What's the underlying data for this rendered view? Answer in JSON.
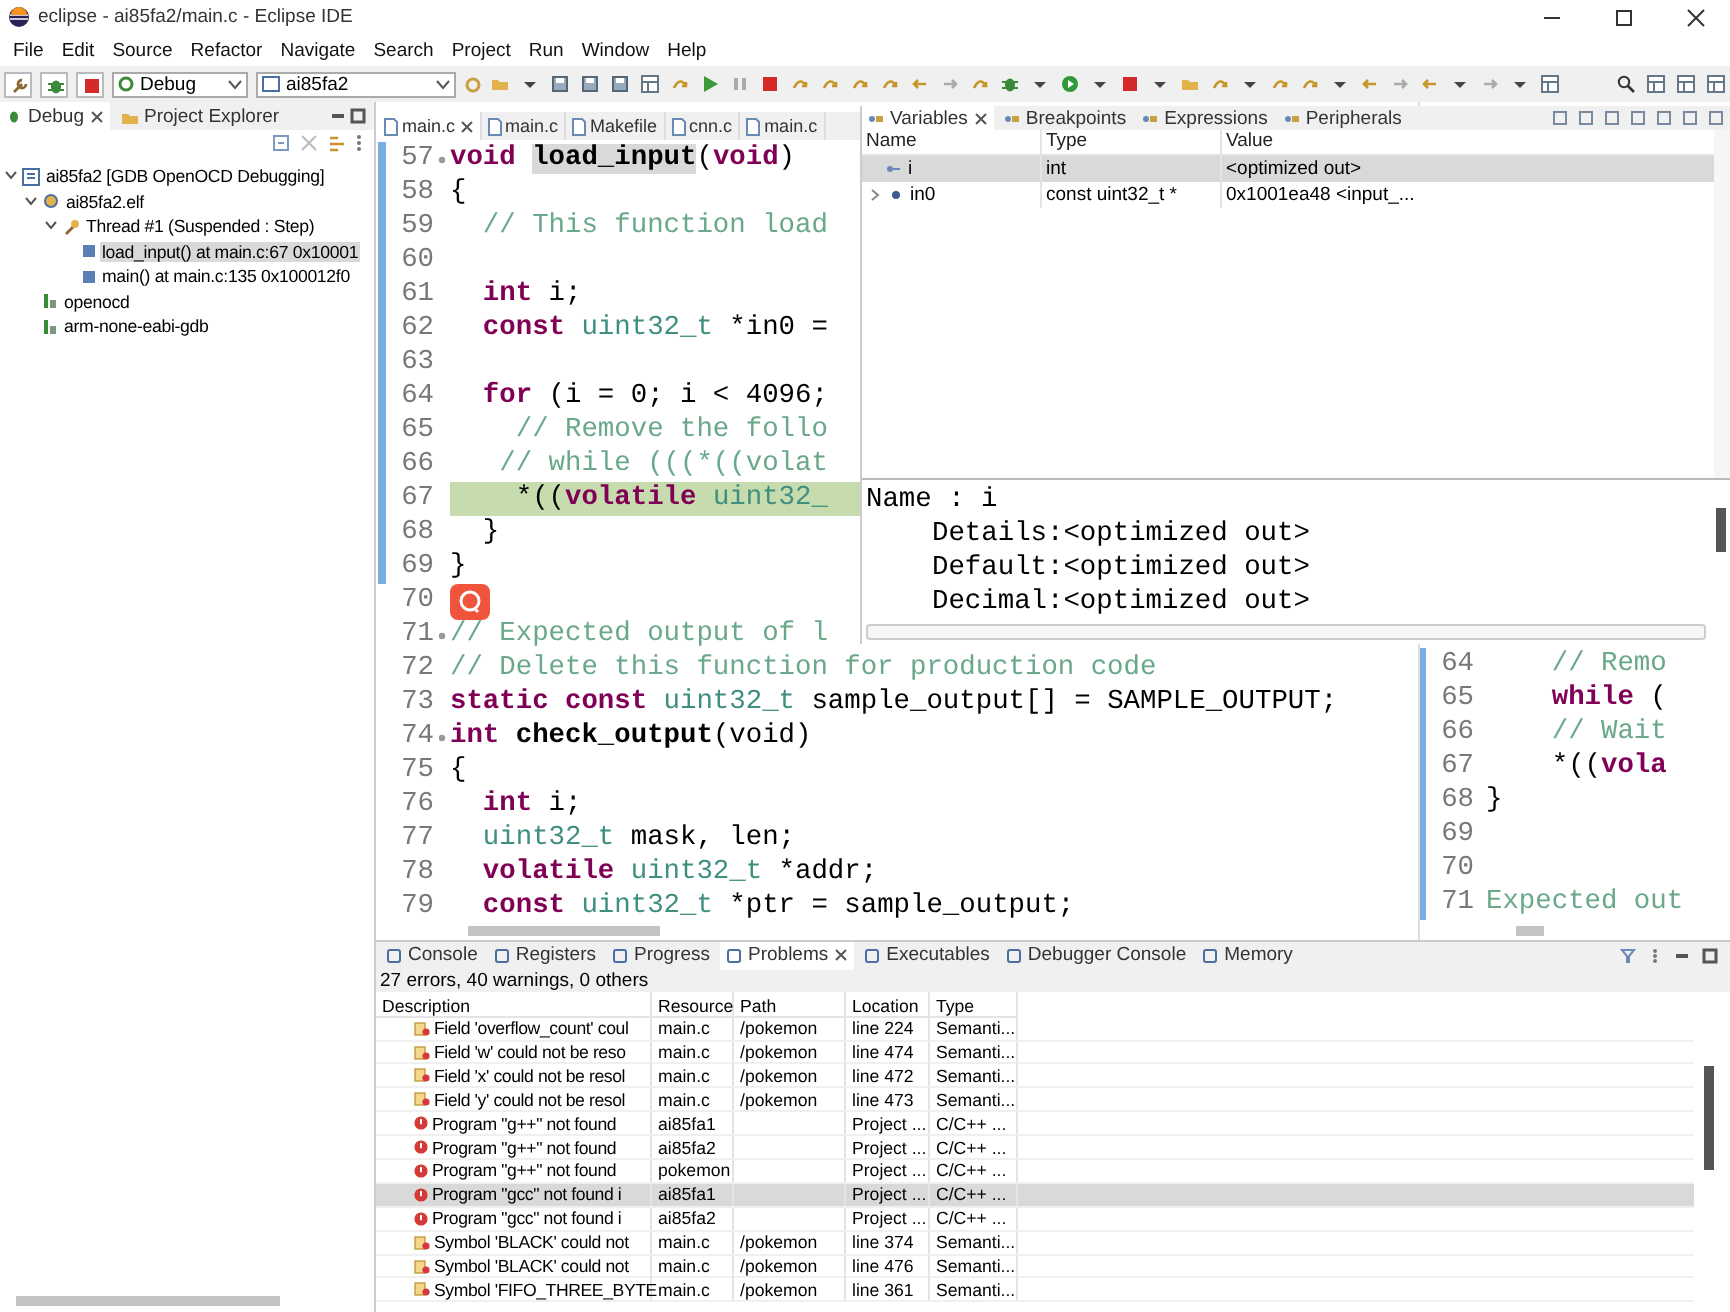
{
  "window": {
    "title": "eclipse - ai85fa2/main.c - Eclipse IDE"
  },
  "menu": [
    "File",
    "Edit",
    "Source",
    "Refactor",
    "Navigate",
    "Search",
    "Project",
    "Run",
    "Window",
    "Help"
  ],
  "toolbar": {
    "launch_mode": "Debug",
    "launch_config": "ai85fa2"
  },
  "debug_view": {
    "tabs": [
      {
        "label": "Debug",
        "selected": true
      },
      {
        "label": "Project Explorer",
        "selected": false
      }
    ],
    "tree": [
      {
        "label": "ai85fa2 [GDB OpenOCD Debugging]",
        "kind": "launch",
        "expanded": true,
        "selected": false,
        "children": [
          {
            "label": "ai85fa2.elf",
            "kind": "program",
            "expanded": true,
            "selected": false,
            "children": [
              {
                "label": "Thread #1 (Suspended : Step)",
                "kind": "thread",
                "expanded": true,
                "selected": false,
                "children": [
                  {
                    "label": "load_input() at main.c:67 0x10001",
                    "kind": "frame",
                    "selected": true
                  },
                  {
                    "label": "main() at main.c:135 0x100012f0",
                    "kind": "frame",
                    "selected": false
                  }
                ]
              }
            ]
          },
          {
            "label": "openocd",
            "kind": "tool",
            "selected": false
          },
          {
            "label": "arm-none-eabi-gdb",
            "kind": "tool",
            "selected": false
          }
        ]
      }
    ]
  },
  "editor": {
    "tabs": [
      {
        "label": "main.c",
        "selected": true
      },
      {
        "label": "main.c",
        "selected": false
      },
      {
        "label": "Makefile",
        "selected": false
      },
      {
        "label": "cnn.c",
        "selected": false
      },
      {
        "label": "main.c",
        "selected": false
      }
    ],
    "lines": [
      {
        "number": "57",
        "foldable": true,
        "range": true,
        "current": false,
        "segments": [
          {
            "text": "void ",
            "kind": "kw"
          },
          {
            "text": "load_input",
            "kind": "occurrence"
          },
          {
            "text": "(",
            "kind": "plain"
          },
          {
            "text": "void",
            "kind": "kw"
          },
          {
            "text": ")",
            "kind": "plain"
          }
        ]
      },
      {
        "number": "58",
        "foldable": false,
        "range": true,
        "current": false,
        "segments": [
          {
            "text": "{",
            "kind": "plain"
          }
        ]
      },
      {
        "number": "59",
        "foldable": false,
        "range": true,
        "current": false,
        "segments": [
          {
            "text": "  // This function load",
            "kind": "comment"
          }
        ]
      },
      {
        "number": "60",
        "foldable": false,
        "range": true,
        "current": false
      },
      {
        "number": "61",
        "foldable": false,
        "range": true,
        "current": false,
        "segments": [
          {
            "text": "  int",
            "kind": "kw"
          },
          {
            "text": " i;",
            "kind": "plain"
          }
        ]
      },
      {
        "number": "62",
        "foldable": false,
        "range": true,
        "current": false,
        "segments": [
          {
            "text": "  const ",
            "kind": "kw"
          },
          {
            "text": "uint32_t",
            "kind": "type"
          },
          {
            "text": " *in0 =",
            "kind": "plain"
          }
        ]
      },
      {
        "number": "63",
        "foldable": false,
        "range": true,
        "current": false
      },
      {
        "number": "64",
        "foldable": false,
        "range": true,
        "current": false,
        "segments": [
          {
            "text": "  for",
            "kind": "kw"
          },
          {
            "text": " (i = 0; i < 4096;",
            "kind": "plain"
          }
        ]
      },
      {
        "number": "65",
        "foldable": false,
        "range": true,
        "current": false,
        "segments": [
          {
            "text": "    // Remove the follo",
            "kind": "comment"
          }
        ]
      },
      {
        "number": "66",
        "foldable": false,
        "range": true,
        "current": false,
        "segments": [
          {
            "text": "   // while (((*((volat",
            "kind": "comment"
          }
        ]
      },
      {
        "number": "67",
        "foldable": false,
        "range": true,
        "current": true,
        "segments": [
          {
            "text": "    *((",
            "kind": "plain"
          },
          {
            "text": "volatile ",
            "kind": "kw"
          },
          {
            "text": "uint32_",
            "kind": "type"
          }
        ]
      },
      {
        "number": "68",
        "foldable": false,
        "range": true,
        "current": false,
        "segments": [
          {
            "text": "  }",
            "kind": "plain"
          }
        ]
      },
      {
        "number": "69",
        "foldable": false,
        "range": true,
        "current": false,
        "segments": [
          {
            "text": "}",
            "kind": "plain"
          }
        ]
      },
      {
        "number": "70",
        "foldable": false,
        "range": false,
        "current": false
      },
      {
        "number": "71",
        "foldable": true,
        "range": false,
        "current": false,
        "segments": [
          {
            "text": "// Expected output of l",
            "kind": "comment"
          }
        ]
      },
      {
        "number": "72",
        "foldable": false,
        "range": false,
        "current": false,
        "segments": [
          {
            "text": "// Delete this function for production code",
            "kind": "comment"
          }
        ]
      },
      {
        "number": "73",
        "foldable": false,
        "range": false,
        "current": false,
        "segments": [
          {
            "text": "static const ",
            "kind": "kw"
          },
          {
            "text": "uint32_t",
            "kind": "type"
          },
          {
            "text": " sample_output[] = SAMPLE_OUTPUT;",
            "kind": "plain"
          }
        ]
      },
      {
        "number": "74",
        "foldable": true,
        "range": false,
        "current": false,
        "segments": [
          {
            "text": "int ",
            "kind": "kw"
          },
          {
            "text": "check_output",
            "kind": "name"
          },
          {
            "text": "(void)",
            "kind": "plain"
          }
        ]
      },
      {
        "number": "75",
        "foldable": false,
        "range": false,
        "current": false,
        "segments": [
          {
            "text": "{",
            "kind": "plain"
          }
        ]
      },
      {
        "number": "76",
        "foldable": false,
        "range": false,
        "current": false,
        "segments": [
          {
            "text": "  int",
            "kind": "kw"
          },
          {
            "text": " i;",
            "kind": "plain"
          }
        ]
      },
      {
        "number": "77",
        "foldable": false,
        "range": false,
        "current": false,
        "segments": [
          {
            "text": "  uint32_t",
            "kind": "type"
          },
          {
            "text": " mask, len;",
            "kind": "plain"
          }
        ]
      },
      {
        "number": "78",
        "foldable": false,
        "range": false,
        "current": false,
        "segments": [
          {
            "text": "  volatile ",
            "kind": "kw"
          },
          {
            "text": "uint32_t",
            "kind": "type"
          },
          {
            "text": " *addr;",
            "kind": "plain"
          }
        ]
      },
      {
        "number": "79",
        "foldable": false,
        "range": false,
        "current": false,
        "segments": [
          {
            "text": "  const ",
            "kind": "kw"
          },
          {
            "text": "uint32_t",
            "kind": "type"
          },
          {
            "text": " *ptr = sample_output;",
            "kind": "plain"
          }
        ]
      }
    ]
  },
  "side_editor": {
    "lines": [
      {
        "number": "64",
        "segments": [
          {
            "text": "    // Remo",
            "kind": "comment"
          }
        ]
      },
      {
        "number": "65",
        "segments": [
          {
            "text": "    while",
            "kind": "kw"
          },
          {
            "text": " (",
            "kind": "plain"
          }
        ]
      },
      {
        "number": "66",
        "segments": [
          {
            "text": "    // Wait",
            "kind": "comment"
          }
        ]
      },
      {
        "number": "67",
        "segments": [
          {
            "text": "    *((",
            "kind": "plain"
          },
          {
            "text": "vola",
            "kind": "kw"
          }
        ]
      },
      {
        "number": "68",
        "segments": [
          {
            "text": "}",
            "kind": "plain"
          }
        ]
      },
      {
        "number": "69"
      },
      {
        "number": "70"
      },
      {
        "number": "71",
        "segments": [
          {
            "text": "Expected out",
            "kind": "comment"
          }
        ]
      }
    ]
  },
  "variables_view": {
    "tabs": [
      {
        "label": "Variables",
        "selected": true
      },
      {
        "label": "Breakpoints",
        "selected": false
      },
      {
        "label": "Expressions",
        "selected": false
      },
      {
        "label": "Peripherals",
        "selected": false
      }
    ],
    "columns": [
      "Name",
      "Type",
      "Value"
    ],
    "rows": [
      {
        "name": "i",
        "type": "int",
        "value": "<optimized out>",
        "selected": true,
        "expandable": false
      },
      {
        "name": "in0",
        "type": "const uint32_t *",
        "value": "0x1001ea48 <input_...",
        "selected": false,
        "expandable": true
      }
    ],
    "detail": {
      "name": "Name : i",
      "fields": [
        "Details:<optimized out>",
        "Default:<optimized out>",
        "Decimal:<optimized out>"
      ]
    }
  },
  "problems_view": {
    "tabs": [
      {
        "label": "Console",
        "selected": false
      },
      {
        "label": "Registers",
        "selected": false
      },
      {
        "label": "Progress",
        "selected": false
      },
      {
        "label": "Problems",
        "selected": true
      },
      {
        "label": "Executables",
        "selected": false
      },
      {
        "label": "Debugger Console",
        "selected": false
      },
      {
        "label": "Memory",
        "selected": false
      }
    ],
    "summary": "27 errors, 40 warnings, 0 others",
    "columns": [
      "Description",
      "Resource",
      "Path",
      "Location",
      "Type"
    ],
    "rows": [
      {
        "kind": "semantic",
        "description": "Field 'overflow_count' coul",
        "resource": "main.c",
        "path": "/pokemon",
        "location": "line 224",
        "type": "Semanti...",
        "selected": false
      },
      {
        "kind": "semantic",
        "description": "Field 'w' could not be reso",
        "resource": "main.c",
        "path": "/pokemon",
        "location": "line 474",
        "type": "Semanti...",
        "selected": false
      },
      {
        "kind": "semantic",
        "description": "Field 'x' could not be resol",
        "resource": "main.c",
        "path": "/pokemon",
        "location": "line 472",
        "type": "Semanti...",
        "selected": false
      },
      {
        "kind": "semantic",
        "description": "Field 'y' could not be resol",
        "resource": "main.c",
        "path": "/pokemon",
        "location": "line 473",
        "type": "Semanti...",
        "selected": false
      },
      {
        "kind": "error",
        "description": "Program \"g++\" not found",
        "resource": "ai85fa1",
        "location": "Project ...",
        "type": "C/C++ ...",
        "selected": false
      },
      {
        "kind": "error",
        "description": "Program \"g++\" not found",
        "resource": "ai85fa2",
        "location": "Project ...",
        "type": "C/C++ ...",
        "selected": false
      },
      {
        "kind": "error",
        "description": "Program \"g++\" not found",
        "resource": "pokemon",
        "location": "Project ...",
        "type": "C/C++ ...",
        "selected": false
      },
      {
        "kind": "error",
        "description": "Program \"gcc\" not found i",
        "resource": "ai85fa1",
        "location": "Project ...",
        "type": "C/C++ ...",
        "selected": true
      },
      {
        "kind": "error",
        "description": "Program \"gcc\" not found i",
        "resource": "ai85fa2",
        "location": "Project ...",
        "type": "C/C++ ...",
        "selected": false
      },
      {
        "kind": "semantic",
        "description": "Symbol 'BLACK' could not",
        "resource": "main.c",
        "path": "/pokemon",
        "location": "line 374",
        "type": "Semanti...",
        "selected": false
      },
      {
        "kind": "semantic",
        "description": "Symbol 'BLACK' could not",
        "resource": "main.c",
        "path": "/pokemon",
        "location": "line 476",
        "type": "Semanti...",
        "selected": false
      },
      {
        "kind": "semantic",
        "description": "Symbol 'FIFO_THREE_BYTE",
        "resource": "main.c",
        "path": "/pokemon",
        "location": "line 361",
        "type": "Semanti...",
        "selected": false
      }
    ]
  }
}
